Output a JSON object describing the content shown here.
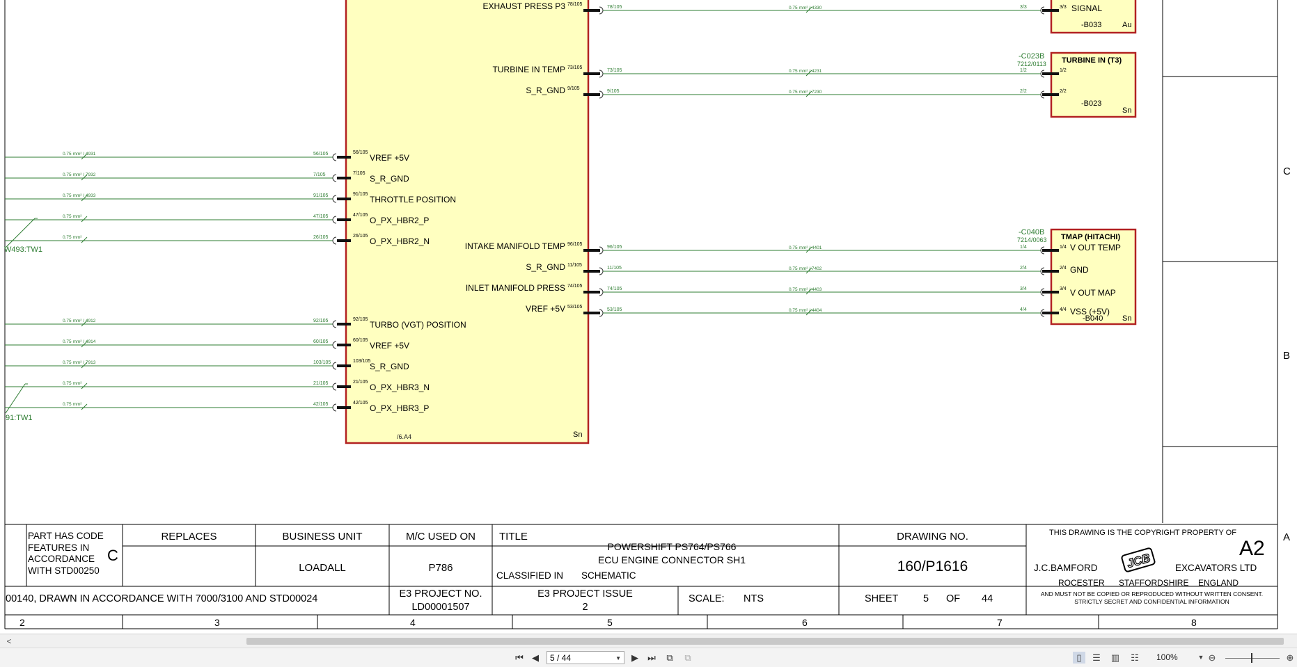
{
  "schematic": {
    "ecu": {
      "right_pins": [
        {
          "label": "EXHAUST PRESS P3",
          "pin": "78/105",
          "wire": "78/105",
          "spec": "0.75 mm² / 4330",
          "dest": "3/3"
        },
        {
          "label": "TURBINE IN TEMP",
          "pin": "73/105",
          "wire": "73/105",
          "spec": "0.75 mm² / 4231",
          "dest": "1/2"
        },
        {
          "label": "S_R_GND",
          "pin": "9/105",
          "wire": "9/105",
          "spec": "0.75 mm² / 7230",
          "dest": "2/2"
        },
        {
          "label": "INTAKE MANIFOLD TEMP",
          "pin": "96/105",
          "wire": "96/105",
          "spec": "0.75 mm² / 4401",
          "dest": "1/4"
        },
        {
          "label": "S_R_GND",
          "pin": "11/105",
          "wire": "11/105",
          "spec": "0.75 mm² / 7402",
          "dest": "2/4"
        },
        {
          "label": "INLET MANIFOLD PRESS",
          "pin": "74/105",
          "wire": "74/105",
          "spec": "0.75 mm² / 4403",
          "dest": "3/4"
        },
        {
          "label": "VREF +5V",
          "pin": "53/105",
          "wire": "53/105",
          "spec": "0.75 mm² / 4404",
          "dest": "4/4"
        }
      ],
      "left_pins": [
        {
          "label": "VREF +5V",
          "pin": "56/105",
          "wire": "56/105",
          "spec": "0.75 mm² / 4931"
        },
        {
          "label": "S_R_GND",
          "pin": "7/105",
          "wire": "7/105",
          "spec": "0.75 mm² / 7932"
        },
        {
          "label": "THROTTLE POSITION",
          "pin": "91/105",
          "wire": "91/105",
          "spec": "0.75 mm² / 4933"
        },
        {
          "label": "O_PX_HBR2_P",
          "pin": "47/105",
          "wire": "47/105",
          "spec": "0.75 mm²"
        },
        {
          "label": "O_PX_HBR2_N",
          "pin": "26/105",
          "wire": "26/105",
          "spec": "0.75 mm²"
        },
        {
          "label": "TURBO (VGT) POSITION",
          "pin": "92/105",
          "wire": "92/105",
          "spec": "0.75 mm² / 4912"
        },
        {
          "label": "VREF +5V",
          "pin": "60/105",
          "wire": "60/105",
          "spec": "0.75 mm² / 4914"
        },
        {
          "label": "S_R_GND",
          "pin": "103/105",
          "wire": "103/105",
          "spec": "0.75 mm² / 7913"
        },
        {
          "label": "O_PX_HBR3_N",
          "pin": "21/105",
          "wire": "21/105",
          "spec": "0.75 mm²"
        },
        {
          "label": "O_PX_HBR3_P",
          "pin": "42/105",
          "wire": "42/105",
          "spec": "0.75 mm²"
        }
      ],
      "ref": "/6.A4",
      "finish": "Sn"
    },
    "twist_labels": [
      "W493:TW1",
      "91:TW1"
    ],
    "comp_b033": {
      "pin_label": "SIGNAL",
      "pin": "3/3",
      "ref": "-B033",
      "finish": "Au"
    },
    "comp_b023": {
      "connector": "-C023B",
      "partno": "7212/0113",
      "title": "TURBINE IN (T3)",
      "pins": [
        "1/2",
        "2/2"
      ],
      "ref": "-B023",
      "finish": "Sn"
    },
    "comp_b040": {
      "connector": "-C040B",
      "partno": "7214/0063",
      "title": "TMAP (HITACHI)",
      "pins": [
        "1/4",
        "2/4",
        "3/4",
        "4/4"
      ],
      "labels": [
        "V OUT TEMP",
        "GND",
        "V OUT MAP",
        "VSS (+5V)"
      ],
      "ref": "-B040",
      "finish": "Sn"
    },
    "zones": [
      "C",
      "B",
      "A"
    ]
  },
  "title_block": {
    "part_has_code": "PART HAS CODE FEATURES IN ACCORDANCE WITH STD00250",
    "part_code_letter": "C",
    "replaces_header": "REPLACES",
    "business_unit_header": "BUSINESS UNIT",
    "business_unit": "LOADALL",
    "mc_used_on_header": "M/C USED ON",
    "mc_used_on": "P786",
    "title_header": "TITLE",
    "title_line1": "POWERSHIFT PS764/PS766",
    "title_line2": "ECU ENGINE CONNECTOR SH1",
    "classified_in_label": "CLASSIFIED IN",
    "classified_in": "SCHEMATIC",
    "drawing_no_header": "DRAWING NO.",
    "drawing_no": "160/P1616",
    "copyright_line": "THIS DRAWING IS THE COPYRIGHT PROPERTY OF",
    "size": "A2",
    "company_left": "J.C.BAMFORD",
    "company_right": "EXCAVATORS LTD",
    "logo_text": "JCB",
    "addr1": "ROCESTER",
    "addr2": "STAFFORDSHIRE",
    "addr3": "ENGLAND",
    "notice1": "AND MUST NOT BE COPIED OR REPRODUCED WITHOUT WRITTEN CONSENT.",
    "notice2": "STRICTLY SECRET AND CONFIDENTIAL INFORMATION",
    "drawn_note": "00140, DRAWN IN ACCORDANCE WITH 7000/3100 AND STD00024",
    "e3_project_no_label": "E3 PROJECT NO.",
    "e3_project_no": "LD00001507",
    "e3_issue_label": "E3 PROJECT ISSUE",
    "e3_issue": "2",
    "scale_label": "SCALE:",
    "scale": "NTS",
    "sheet_label": "SHEET",
    "sheet": "5",
    "of_label": "OF",
    "sheet_total": "44",
    "columns": [
      "2",
      "3",
      "4",
      "5",
      "6",
      "7",
      "8"
    ]
  },
  "viewer": {
    "page_field": "5 / 44",
    "zoom": "100%"
  },
  "colors": {
    "ecu_fill": "#ffffc0",
    "border": "#b22222",
    "wire": "#2e7d32"
  }
}
